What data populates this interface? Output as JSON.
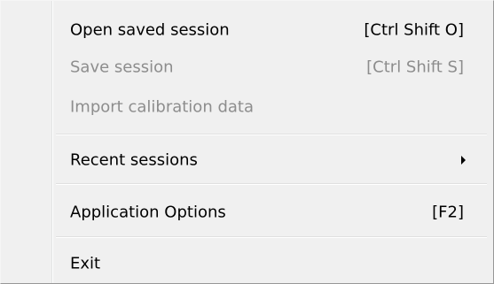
{
  "menu": {
    "items": [
      {
        "label": "Open saved session",
        "shortcut": "[Ctrl Shift O]",
        "enabled": true
      },
      {
        "label": "Save session",
        "shortcut": "[Ctrl Shift S]",
        "enabled": false
      },
      {
        "label": "Import calibration data",
        "shortcut": "",
        "enabled": false
      },
      {
        "label": "Recent sessions",
        "shortcut": "",
        "enabled": true,
        "submenu_icon": "submenu-arrow-icon"
      },
      {
        "label": "Application Options",
        "shortcut": "[F2]",
        "enabled": true
      },
      {
        "label": "Exit",
        "shortcut": "",
        "enabled": true
      }
    ]
  }
}
